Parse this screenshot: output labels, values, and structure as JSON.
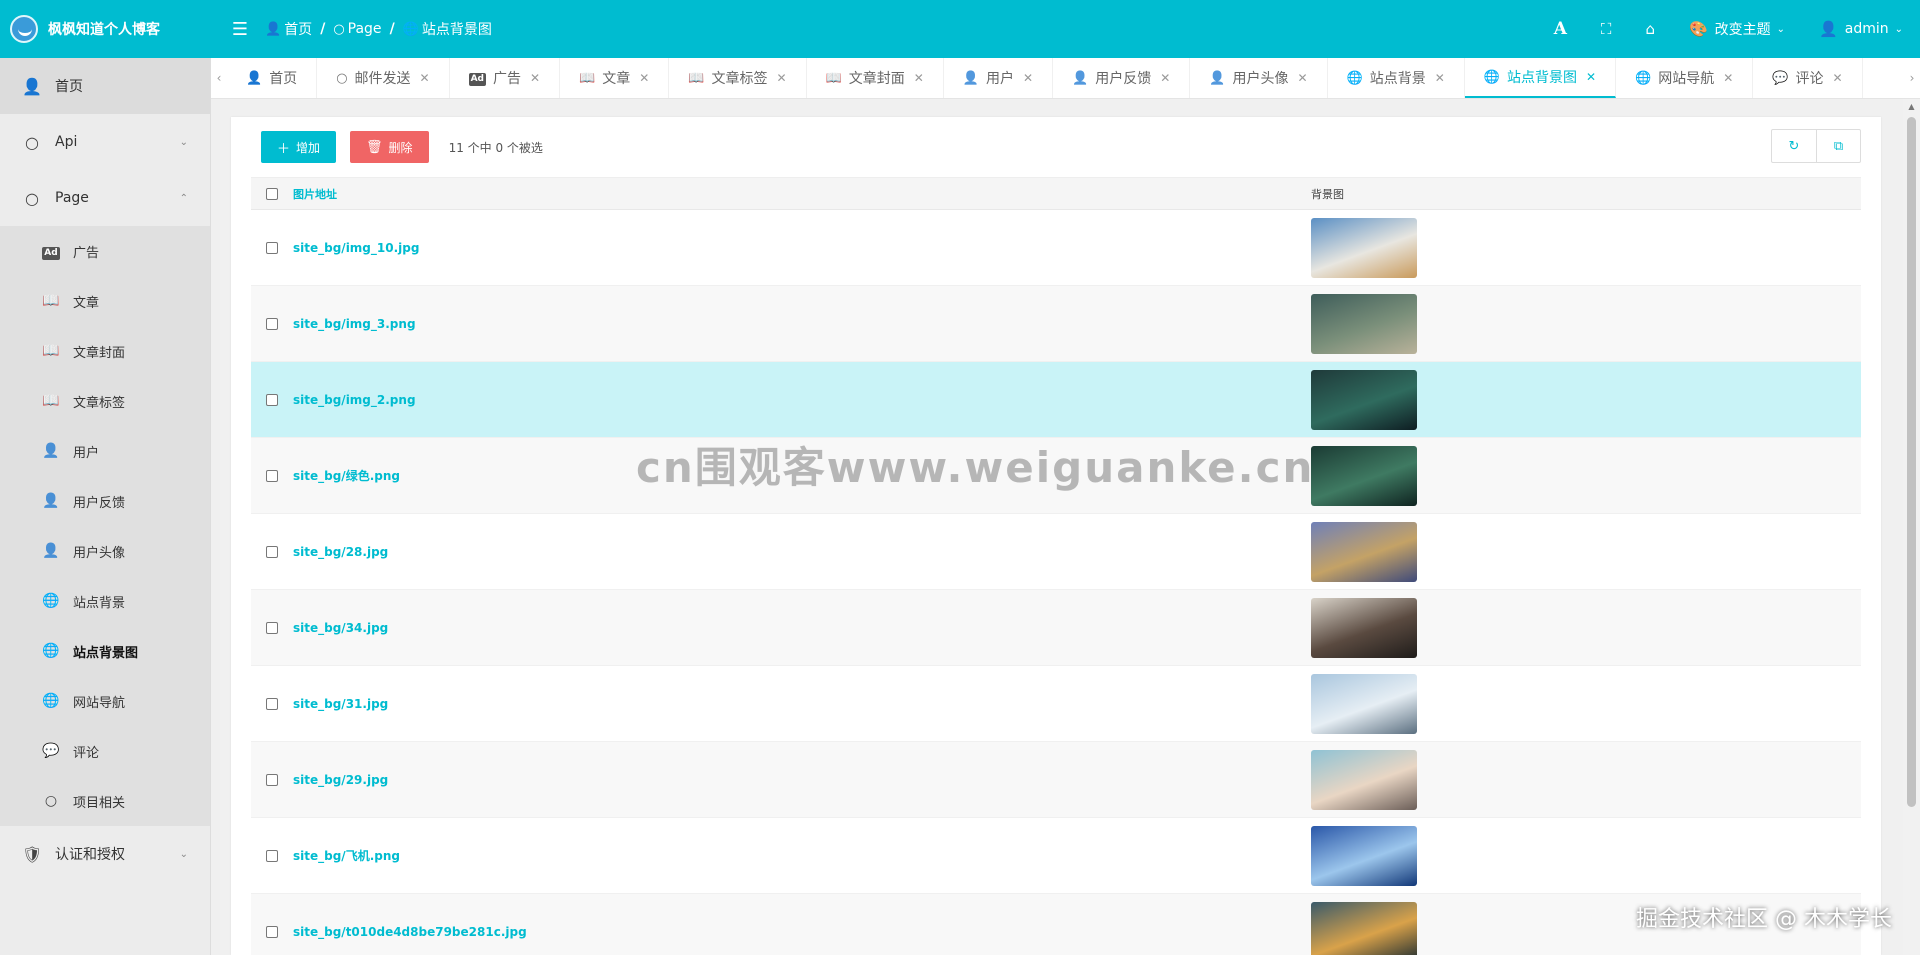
{
  "app": {
    "title": "枫枫知道个人博客"
  },
  "breadcrumb": [
    {
      "label": "首页",
      "icon": "user-icon"
    },
    {
      "label": "Page",
      "icon": "circle-icon"
    },
    {
      "label": "站点背景图",
      "icon": "globe-icon"
    }
  ],
  "topbar": {
    "font_icon_label": "A",
    "theme_label": "改变主题",
    "user_label": "admin"
  },
  "sidebar": {
    "items": [
      {
        "label": "首页",
        "icon": "user-icon"
      },
      {
        "label": "Api",
        "icon": "circle-icon"
      },
      {
        "label": "Page",
        "icon": "circle-icon"
      },
      {
        "label": "认证和授权",
        "icon": "shield-icon"
      }
    ],
    "page_children": [
      {
        "label": "广告",
        "icon": "ad-icon"
      },
      {
        "label": "文章",
        "icon": "book-icon"
      },
      {
        "label": "文章封面",
        "icon": "book-icon"
      },
      {
        "label": "文章标签",
        "icon": "book-icon"
      },
      {
        "label": "用户",
        "icon": "user-outline-icon"
      },
      {
        "label": "用户反馈",
        "icon": "user-outline-icon"
      },
      {
        "label": "用户头像",
        "icon": "user-outline-icon"
      },
      {
        "label": "站点背景",
        "icon": "globe-icon"
      },
      {
        "label": "站点背景图",
        "icon": "globe-icon"
      },
      {
        "label": "网站导航",
        "icon": "globe-icon"
      },
      {
        "label": "评论",
        "icon": "comments-icon"
      },
      {
        "label": "项目相关",
        "icon": "circle-icon"
      }
    ]
  },
  "tabs": [
    {
      "label": "首页",
      "icon": "user-icon",
      "closable": false,
      "active": false
    },
    {
      "label": "邮件发送",
      "icon": "circle-icon",
      "closable": true,
      "active": false
    },
    {
      "label": "广告",
      "icon": "ad-icon",
      "closable": true,
      "active": false
    },
    {
      "label": "文章",
      "icon": "book-icon",
      "closable": true,
      "active": false
    },
    {
      "label": "文章标签",
      "icon": "book-icon",
      "closable": true,
      "active": false
    },
    {
      "label": "文章封面",
      "icon": "book-icon",
      "closable": true,
      "active": false
    },
    {
      "label": "用户",
      "icon": "user-outline-icon",
      "closable": true,
      "active": false
    },
    {
      "label": "用户反馈",
      "icon": "user-outline-icon",
      "closable": true,
      "active": false
    },
    {
      "label": "用户头像",
      "icon": "user-outline-icon",
      "closable": true,
      "active": false
    },
    {
      "label": "站点背景",
      "icon": "globe-icon",
      "closable": true,
      "active": false
    },
    {
      "label": "站点背景图",
      "icon": "globe-icon",
      "closable": true,
      "active": true
    },
    {
      "label": "网站导航",
      "icon": "globe-icon",
      "closable": true,
      "active": false
    },
    {
      "label": "评论",
      "icon": "comments-icon",
      "closable": true,
      "active": false
    }
  ],
  "toolbar": {
    "add_label": "增加",
    "delete_label": "删除",
    "selection_info": "11 个中 0 个被选"
  },
  "table": {
    "columns": [
      "图片地址",
      "背景图"
    ],
    "rows": [
      {
        "path": "site_bg/img_10.jpg",
        "thumb_colors": [
          "#5a8fc4",
          "#e8e6e0",
          "#c99a5b"
        ]
      },
      {
        "path": "site_bg/img_3.png",
        "thumb_colors": [
          "#3e5d5a",
          "#7a8f7a",
          "#b9b29a"
        ]
      },
      {
        "path": "site_bg/img_2.png",
        "thumb_colors": [
          "#1f3a3a",
          "#2f6b5e",
          "#0e1d22"
        ]
      },
      {
        "path": "site_bg/绿色.png",
        "thumb_colors": [
          "#1b3b34",
          "#3f7a62",
          "#0f2320"
        ]
      },
      {
        "path": "site_bg/28.jpg",
        "thumb_colors": [
          "#6f80b8",
          "#c4a266",
          "#3f4a7a"
        ]
      },
      {
        "path": "site_bg/34.jpg",
        "thumb_colors": [
          "#d9d3c9",
          "#5a4a40",
          "#1f1c1a"
        ]
      },
      {
        "path": "site_bg/31.jpg",
        "thumb_colors": [
          "#a9c6de",
          "#e6eef4",
          "#5b6f80"
        ]
      },
      {
        "path": "site_bg/29.jpg",
        "thumb_colors": [
          "#8fc2d4",
          "#e9d6c4",
          "#6b5e58"
        ]
      },
      {
        "path": "site_bg/飞机.png",
        "thumb_colors": [
          "#2a57a8",
          "#9cc6ec",
          "#123878"
        ]
      },
      {
        "path": "site_bg/t010de4d8be79be281c.jpg",
        "thumb_colors": [
          "#3a5a6a",
          "#d9a24a",
          "#1a2a30"
        ]
      }
    ]
  },
  "overlays": {
    "watermark": "cn围观客www.weiguanke.cn",
    "footer": "掘金技术社区 @ 木木学长"
  },
  "colors": {
    "accent": "#00bcd0",
    "danger": "#f06565",
    "hover_row": "#c9f3f7"
  }
}
